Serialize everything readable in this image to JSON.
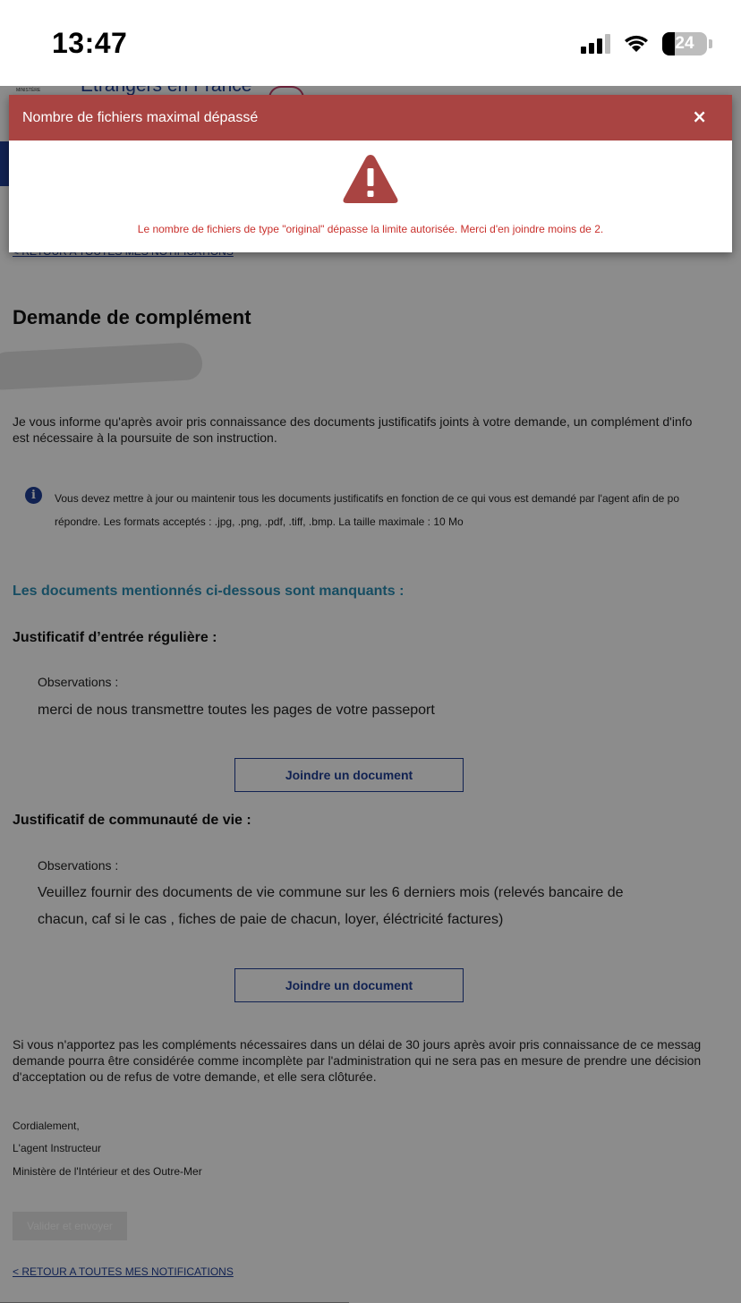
{
  "status_bar": {
    "time": "13:47",
    "battery": "24"
  },
  "site": {
    "logo_text": "MINISTÈRE",
    "title": "Etrangers en France"
  },
  "modal": {
    "title": "Nombre de fichiers maximal dépassé",
    "close_glyph": "×",
    "message": "Le nombre de fichiers de type \"original\" dépasse la limite autorisée. Merci d'en joindre moins de 2.",
    "icon": "warning-triangle-icon",
    "header_color": "#a94442"
  },
  "page": {
    "back_link_top": "< RETOUR A TOUTES MES NOTIFICATIONS",
    "title": "Demande de complément",
    "intro_line1": "Je vous informe qu'après avoir pris connaissance des documents justificatifs joints à votre demande, un complément d'info",
    "intro_line2": "est nécessaire à la poursuite de son instruction.",
    "info_line1": "Vous devez mettre à jour ou maintenir tous les documents justificatifs en fonction de ce qui vous est demandé par l'agent afin de po",
    "info_line2": "répondre. Les formats acceptés : .jpg, .png, .pdf, .tiff, .bmp. La taille maximale : 10 Mo",
    "missing_heading": "Les documents mentionnés ci-dessous sont manquants :",
    "documents": [
      {
        "title": "Justificatif d’entrée régulière :",
        "observations_label": "Observations :",
        "observations_line1": "merci de nous transmettre toutes les pages de votre passeport",
        "observations_line2": "",
        "button_label": "Joindre un document"
      },
      {
        "title": "Justificatif de communauté de vie :",
        "observations_label": "Observations :",
        "observations_line1": "Veuillez fournir des documents de vie commune sur les 6 derniers mois (relevés bancaire de",
        "observations_line2": "chacun, caf si le cas , fiches de paie de chacun, loyer, éléctricité factures)",
        "button_label": "Joindre un document"
      }
    ],
    "warning_line1": "Si vous n'apportez pas les compléments nécessaires dans un délai de 30 jours après avoir pris connaissance de ce messag",
    "warning_line2": "demande pourra être considérée comme incomplète par l'administration qui ne sera pas en mesure de prendre une décision",
    "warning_line3": "d'acceptation ou de refus de votre demande, et elle sera clôturée.",
    "signature": [
      "Cordialement,",
      "L'agent Instructeur",
      "Ministère de l'Intérieur et des Outre-Mer"
    ],
    "validate_button": "Valider et envoyer",
    "back_link_bottom": "< RETOUR A TOUTES MES NOTIFICATIONS"
  },
  "colors": {
    "primary": "#1f3f95",
    "accent": "#2a8db3",
    "danger": "#c9302c"
  }
}
